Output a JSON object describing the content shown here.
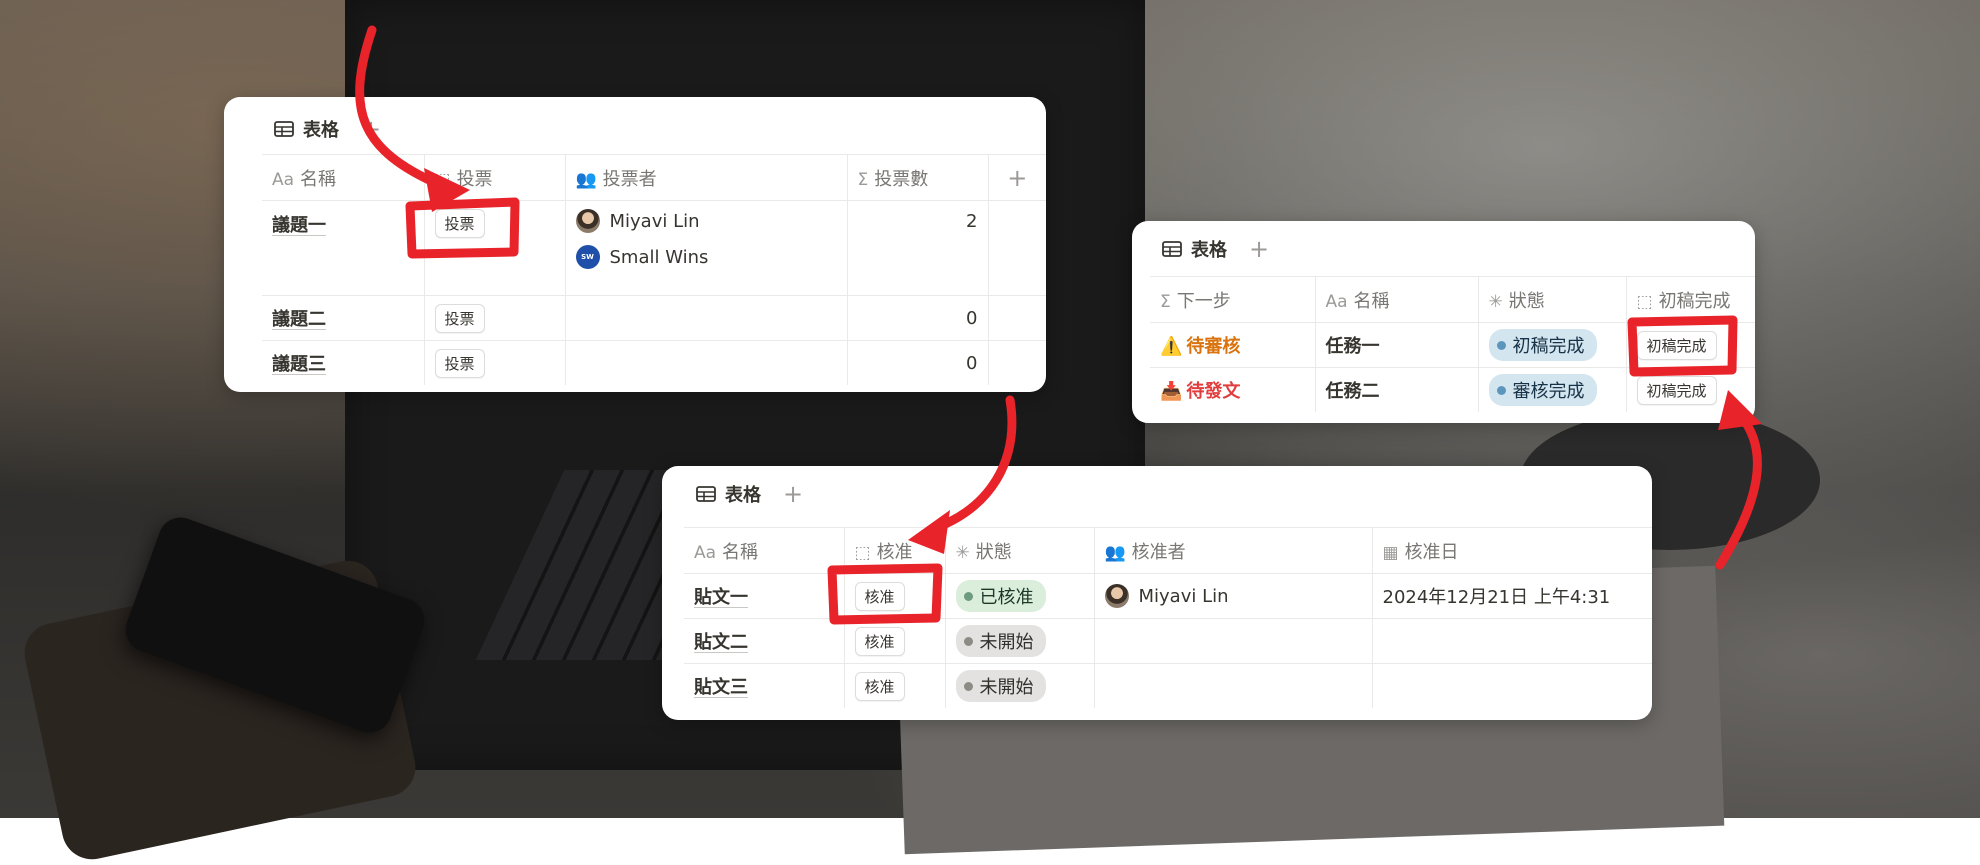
{
  "colors": {
    "annotation_red": "#e8232a",
    "pill_green": "#dbeddb",
    "pill_gray": "#e3e2e0",
    "pill_blue": "#d3e5ef"
  },
  "card_votes": {
    "view_name": "表格",
    "columns": [
      "名稱",
      "投票",
      "投票者",
      "投票數"
    ],
    "column_icons": [
      "text-aa-icon",
      "button-icon",
      "people-icon",
      "sigma-icon"
    ],
    "rows": [
      {
        "name": "議題一",
        "button": "投票",
        "voters": [
          "Miyavi Lin",
          "Small Wins"
        ],
        "count": "2"
      },
      {
        "name": "議題二",
        "button": "投票",
        "voters": [],
        "count": "0"
      },
      {
        "name": "議題三",
        "button": "投票",
        "voters": [],
        "count": "0"
      }
    ]
  },
  "card_approve": {
    "view_name": "表格",
    "columns": [
      "名稱",
      "核准",
      "狀態",
      "核准者",
      "核准日"
    ],
    "rows": [
      {
        "name": "貼文一",
        "button": "核准",
        "status": "已核准",
        "approver": "Miyavi Lin",
        "date": "2024年12月21日 上午4:31"
      },
      {
        "name": "貼文二",
        "button": "核准",
        "status": "未開始",
        "approver": "",
        "date": ""
      },
      {
        "name": "貼文三",
        "button": "核准",
        "status": "未開始",
        "approver": "",
        "date": ""
      }
    ]
  },
  "card_tasks": {
    "view_name": "表格",
    "columns": [
      "下一步",
      "名稱",
      "狀態",
      "初稿完成"
    ],
    "rows": [
      {
        "next": "待審核",
        "next_icon": "warning-icon",
        "name": "任務一",
        "status": "初稿完成",
        "button": "初稿完成"
      },
      {
        "next": "待發文",
        "next_icon": "inbox-tray-icon",
        "name": "任務二",
        "status": "審核完成",
        "button": "初稿完成"
      }
    ]
  }
}
